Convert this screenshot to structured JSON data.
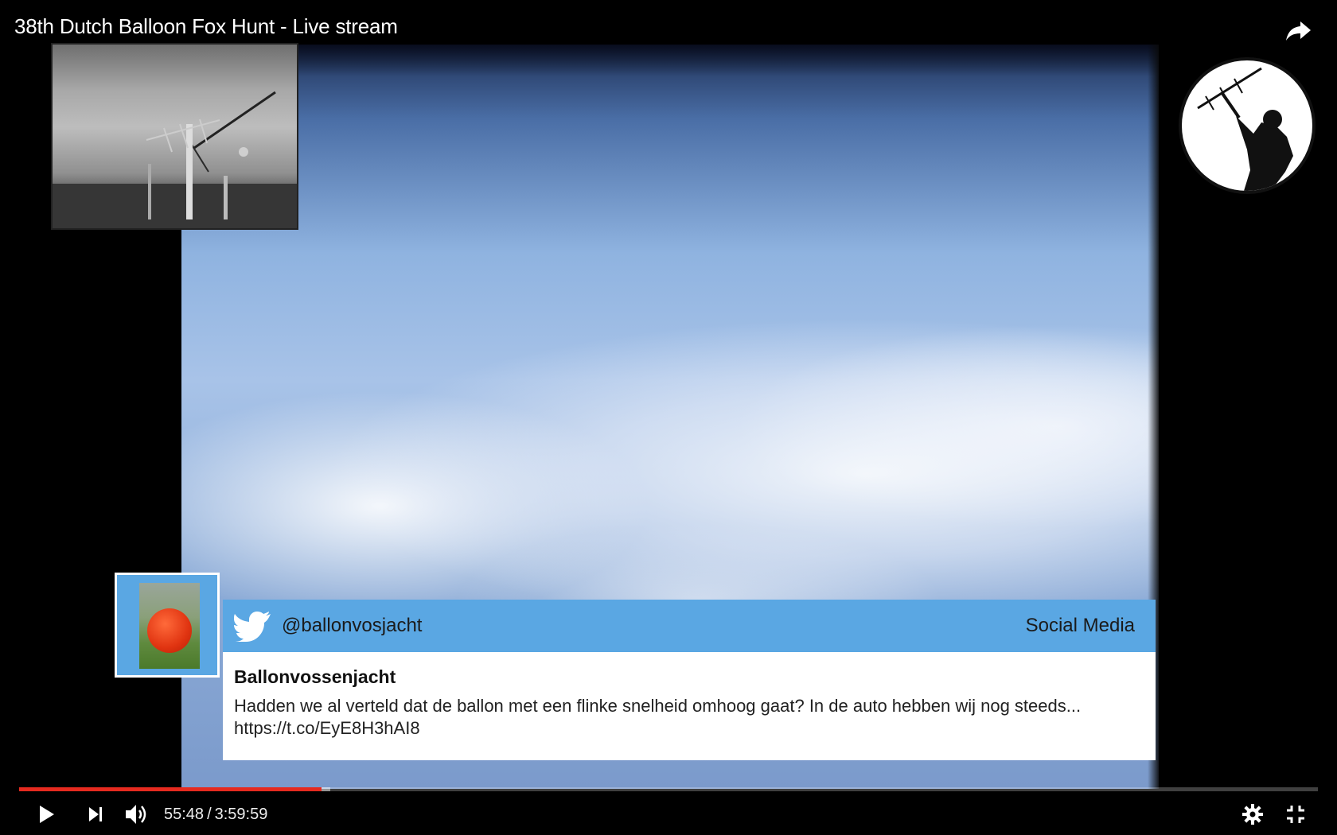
{
  "video": {
    "title": "38th Dutch Balloon Fox Hunt - Live stream"
  },
  "tweet": {
    "handle": "@ballonvosjacht",
    "source_label": "Social Media",
    "author": "Ballonvossenjacht",
    "text": "Hadden we al verteld dat de ballon met een flinke snelheid omhoog gaat? In de auto hebben wij nog steeds... https://t.co/EyE8H3hAI8",
    "header_color": "#5aa7e3"
  },
  "player": {
    "current_time": "55:48",
    "separator": "/",
    "duration": "3:59:59",
    "progress_fraction": 0.2326,
    "buffered_fraction": 0.2395,
    "accent_color": "#e52a1f",
    "icons": {
      "share": "share-icon",
      "play": "play-icon",
      "next": "next-icon",
      "volume": "volume-icon",
      "settings": "gear-icon",
      "exit_fullscreen": "exit-fullscreen-icon"
    }
  }
}
